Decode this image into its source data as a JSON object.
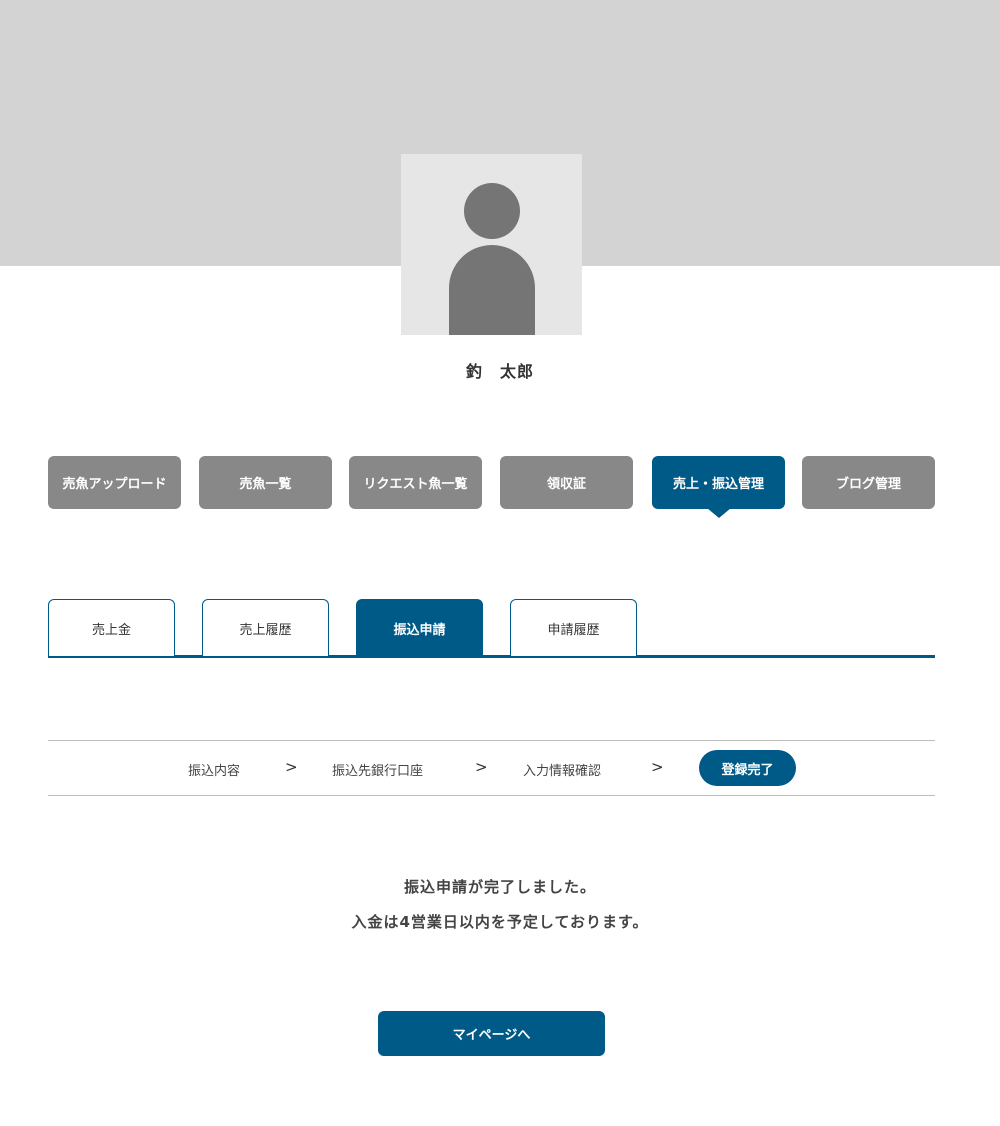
{
  "profile": {
    "name": "釣　太郎"
  },
  "main_nav": {
    "items": [
      {
        "label": "売魚アップロード"
      },
      {
        "label": "売魚一覧"
      },
      {
        "label": "リクエスト魚一覧"
      },
      {
        "label": "領収証"
      },
      {
        "label": "売上・振込管理",
        "active": true
      },
      {
        "label": "ブログ管理"
      }
    ]
  },
  "sub_tabs": {
    "items": [
      {
        "label": "売上金"
      },
      {
        "label": "売上履歴"
      },
      {
        "label": "振込申請",
        "active": true
      },
      {
        "label": "申請履歴"
      }
    ]
  },
  "steps": {
    "items": [
      {
        "label": "振込内容"
      },
      {
        "label": "振込先銀行口座"
      },
      {
        "label": "入力情報確認"
      },
      {
        "label": "登録完了",
        "current": true
      }
    ],
    "separator": ">"
  },
  "message": {
    "line1": "振込申請が完了しました。",
    "line2": "入金は4営業日以内を予定しております。"
  },
  "actions": {
    "mypage_label": "マイページへ"
  },
  "colors": {
    "accent": "#005a87",
    "nav_inactive": "#888888",
    "cover": "#d3d3d3",
    "avatar_bg": "#e6e6e6",
    "avatar_fg": "#757575"
  },
  "icons": {
    "avatar": "user-silhouette-icon"
  }
}
